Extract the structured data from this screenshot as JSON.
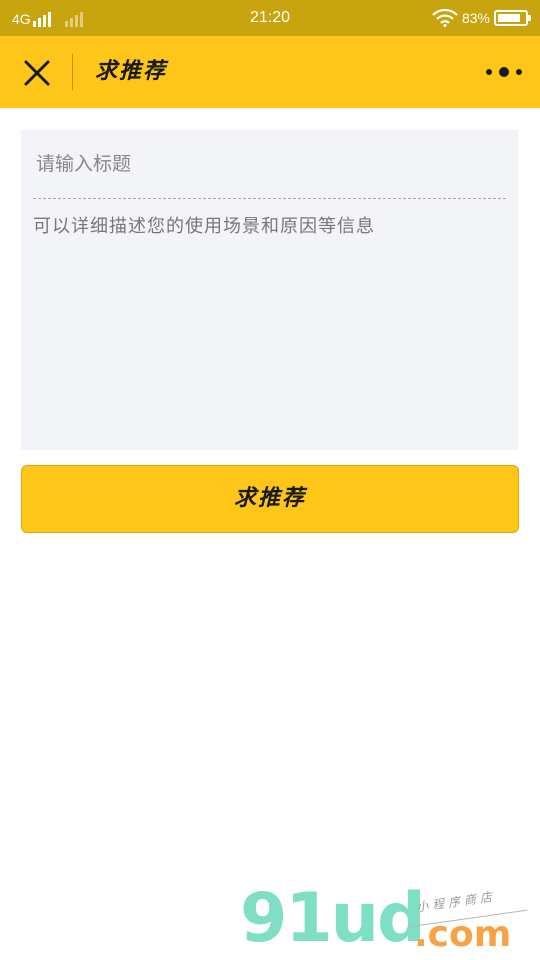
{
  "status_bar": {
    "network": "4G",
    "time": "21:20",
    "battery_percent": "83%",
    "battery_level": 0.83,
    "icons": [
      "signal-icon",
      "wifi-icon",
      "battery-icon"
    ]
  },
  "navbar": {
    "title": "求推荐",
    "close_icon": "close-icon",
    "more_icon": "more-dots-icon"
  },
  "form": {
    "title_placeholder": "请输入标题",
    "title_value": "",
    "description_placeholder": "可以详细描述您的使用场景和原因等信息",
    "description_value": ""
  },
  "submit": {
    "label": "求推荐"
  },
  "watermark": {
    "logo": "91ud",
    "suffix": ".com",
    "tagline": "小程序商店"
  },
  "colors": {
    "status_bar": "#C8A40E",
    "accent": "#FEC619",
    "card_bg": "#F3F4F8",
    "watermark_green": "#7EDFC4",
    "watermark_orange": "#F6A245"
  }
}
